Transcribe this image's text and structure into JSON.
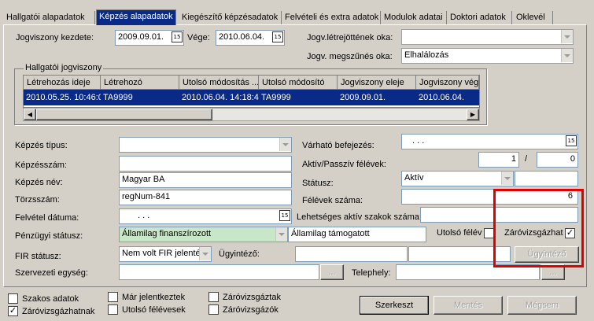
{
  "tabs": [
    {
      "label": "Hallgatói alapadatok"
    },
    {
      "label": "Képzés alapadatok"
    },
    {
      "label": "Kiegészítő képzésadatok"
    },
    {
      "label": "Felvételi és extra adatok"
    },
    {
      "label": "Modulok adatai"
    },
    {
      "label": "Doktori adatok"
    },
    {
      "label": "Oklevél"
    }
  ],
  "top": {
    "jogviszony_kezdete_label": "Jogviszony kezdete:",
    "jogviszony_kezdete_value": "2009.09.01.",
    "vege_label": "Vége:",
    "vege_value": "2010.06.04.",
    "letrejott_label": "Jogv.létrejöttének oka:",
    "letrejott_value": "",
    "megszunes_label": "Jogv. megszűnés oka:",
    "megszunes_value": "Elhalálozás"
  },
  "grid": {
    "group_label": "Hallgatói jogviszony",
    "columns": [
      "Létrehozás ideje",
      "Létrehozó",
      "Utolsó módosítás ...",
      "Utolsó módosító",
      "Jogviszony eleje",
      "Jogviszony vége"
    ],
    "rows": [
      [
        "2010.05.25. 10:46:05",
        "TA9999",
        "2010.06.04. 14:18:45",
        "TA9999",
        "2009.09.01.",
        "2010.06.04."
      ]
    ]
  },
  "form": {
    "kepzes_tipus_label": "Képzés típus:",
    "kepzes_tipus_value": "",
    "kepzesszam_label": "Képzésszám:",
    "kepzesszam_value": "",
    "kepzes_nev_label": "Képzés név:",
    "kepzes_nev_value": "Magyar BA",
    "torzsszam_label": "Törzsszám:",
    "torzsszam_value": "regNum-841",
    "felvetel_datuma_label": "Felvétel dátuma:",
    "felvetel_datuma_value": ". . .",
    "penzugyi_statusz_label": "Pénzügyi státusz:",
    "penzugyi_statusz_value": "Államilag finanszírozott",
    "penzugyi_statusz_2": "Államilag támogatott",
    "fir_statusz_label": "FIR státusz:",
    "fir_statusz_value": "Nem volt FIR jelentés",
    "ugyintezo_label": "Ügyintéző:",
    "ugyintezo_value": "",
    "ugyintezo_button": "Ügyintéző",
    "szervezeti_egyseg_label": "Szervezeti egység:",
    "szervezeti_egyseg_value": "",
    "ellipsis_button": "...",
    "telephely_label": "Telephely:",
    "telephely_value": "",
    "varhato_befejezes_label": "Várható befejezés:",
    "varhato_befejezes_value": ". . .",
    "aktiv_passziv_label": "Aktív/Passzív félévek:",
    "aktiv_felevek": "1",
    "slash": "/",
    "passziv_felevek": "0",
    "statusz_label": "Státusz:",
    "statusz_value": "Aktív",
    "felevek_szama_label": "Félévek száma:",
    "felevek_szama_value": "6",
    "lehetseges_label": "Lehetséges aktív szakok száma:",
    "lehetseges_value": "",
    "utolso_felev_label": "Utolsó félév",
    "utolso_felev_checked": false,
    "zarovizsgazhat_label": "Záróvizsgázhat",
    "zarovizsgazhat_checked": true
  },
  "bottom": {
    "checks": [
      {
        "label": "Szakos adatok",
        "checked": false
      },
      {
        "label": "Záróvizsgázhatnak",
        "checked": true
      },
      {
        "label": "Már jelentkeztek",
        "checked": false
      },
      {
        "label": "Utolsó félévesek",
        "checked": false
      },
      {
        "label": "Záróvizsgáztak",
        "checked": false
      },
      {
        "label": "Záróvizsgázók",
        "checked": false
      }
    ],
    "szerkeszt": "Szerkeszt",
    "mentes": "Mentés",
    "megsem": "Mégsem"
  },
  "colors": {
    "highlight_border": "#e00000",
    "selected_row": "#0a2a88",
    "finance_bg": "#c8e6c8"
  },
  "icons": {
    "calendar": "calendar-icon",
    "dropdown": "chevron-down-icon",
    "check": "check-icon"
  }
}
